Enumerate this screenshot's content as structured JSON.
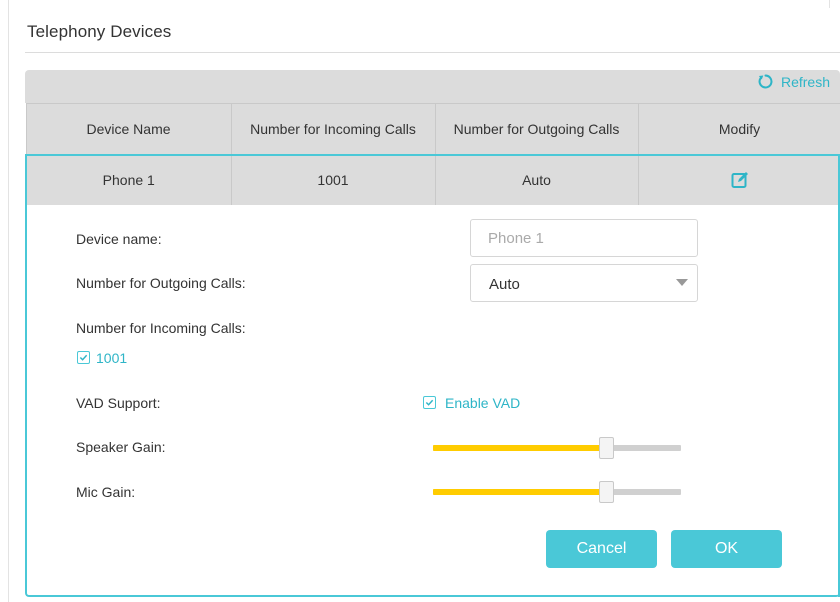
{
  "section": {
    "title": "Telephony Devices"
  },
  "toolbar": {
    "refresh_label": "Refresh"
  },
  "table": {
    "columns": [
      "Device Name",
      "Number for Incoming Calls",
      "Number for Outgoing Calls",
      "Modify"
    ],
    "rows": [
      {
        "device_name": "Phone 1",
        "incoming": "1001",
        "outgoing": "Auto",
        "modify_icon": "edit-icon"
      }
    ]
  },
  "editor": {
    "device_name_label": "Device name:",
    "device_name_placeholder": "Phone 1",
    "outgoing_label": "Number for Outgoing Calls:",
    "outgoing_value": "Auto",
    "incoming_label": "Number for Incoming Calls:",
    "incoming_options": [
      {
        "label": "1001",
        "checked": true
      }
    ],
    "vad_label": "VAD Support:",
    "vad_option_label": "Enable VAD",
    "vad_checked": true,
    "speaker_gain_label": "Speaker Gain:",
    "speaker_gain_level": 0.69,
    "mic_gain_label": "Mic Gain:",
    "mic_gain_level": 0.69,
    "cancel_label": "Cancel",
    "ok_label": "OK"
  },
  "colors": {
    "accent": "#4ac8d7",
    "accent_text": "#2eb5c7",
    "slider_fill": "#ffcc00",
    "header_bg": "#dcdcdc"
  }
}
